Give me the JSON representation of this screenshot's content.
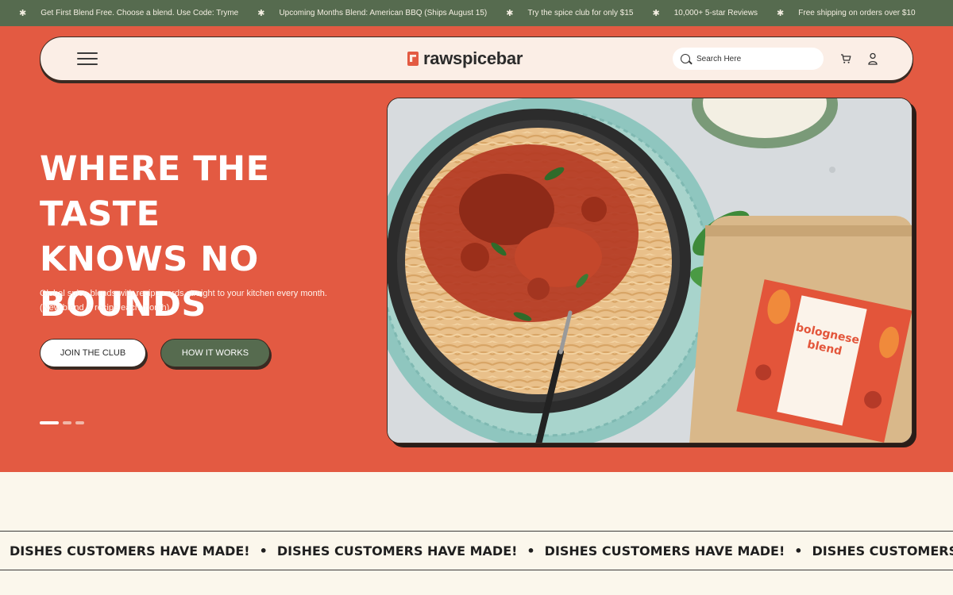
{
  "announcement": {
    "items": [
      "Get First Blend Free. Choose a blend.  Use Code: Tryme",
      "Upcoming Months Blend: American BBQ (Ships August 15)",
      "Try the spice club for  only $15",
      "10,000+ 5-star Reviews",
      "Free shipping on orders over $10"
    ],
    "separator": "✱"
  },
  "header": {
    "menu_icon": "hamburger-menu-icon",
    "logo_text": "rawspicebar",
    "search_placeholder": "Search Here",
    "cart_icon": "cart-icon",
    "account_icon": "user-icon"
  },
  "hero": {
    "title_lines": [
      "WHERE THE TASTE",
      "KNOWS NO",
      "BOUNDS"
    ],
    "subtitle": "Global spice blends with recipe cards straight to your kitchen every month. (New blend & recipe each month)",
    "primary_button": "JOIN THE CLUB",
    "secondary_button": "HOW IT WORKS",
    "slides": 3,
    "active_slide": 1,
    "image_label": "spaghetti bolognese with spice pouch",
    "pouch_text": "bolognese blend"
  },
  "marquee": {
    "text": "DISHES CUSTOMERS HAVE MADE!",
    "separator": "•"
  },
  "colors": {
    "hero_bg": "#e35a42",
    "topbar_bg": "#566b4f",
    "cream": "#fbf7ec",
    "secondary_btn": "#566b4f"
  }
}
